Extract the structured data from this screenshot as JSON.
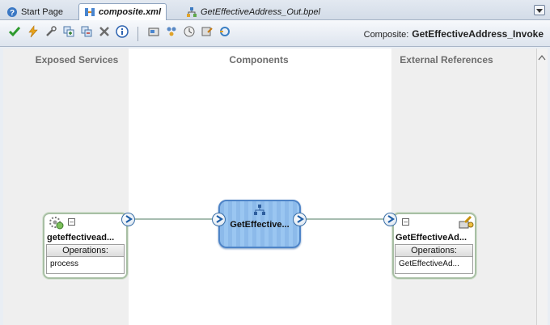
{
  "tabs": [
    {
      "label": "Start Page",
      "icon": "help-icon"
    },
    {
      "label": "composite.xml",
      "icon": "composite-icon",
      "active": true
    },
    {
      "label": "GetEffectiveAddress_Out.bpel",
      "icon": "bpel-icon"
    }
  ],
  "toolbar": {
    "buttons": [
      "validate-icon",
      "lightning-icon",
      "wrench-icon",
      "add-node-icon",
      "copy-node-icon",
      "delete-icon",
      "info-icon",
      "tool1-icon",
      "tool2-icon",
      "tool3-icon",
      "tool4-icon",
      "tool5-icon"
    ],
    "composite_prefix": "Composite:",
    "composite_name": "GetEffectiveAddress_Invoke"
  },
  "lanes": {
    "exposed": "Exposed Services",
    "components": "Components",
    "external": "External References"
  },
  "service": {
    "name": "geteffectivead...",
    "ops_header": "Operations:",
    "operation": "process"
  },
  "component": {
    "name": "GetEffective..."
  },
  "reference": {
    "name": "GetEffectiveAd...",
    "ops_header": "Operations:",
    "operation": "GetEffectiveAd..."
  },
  "colors": {
    "accent": "#4e84c7",
    "wire": "#a7bdb0",
    "lane": "#efefef"
  }
}
